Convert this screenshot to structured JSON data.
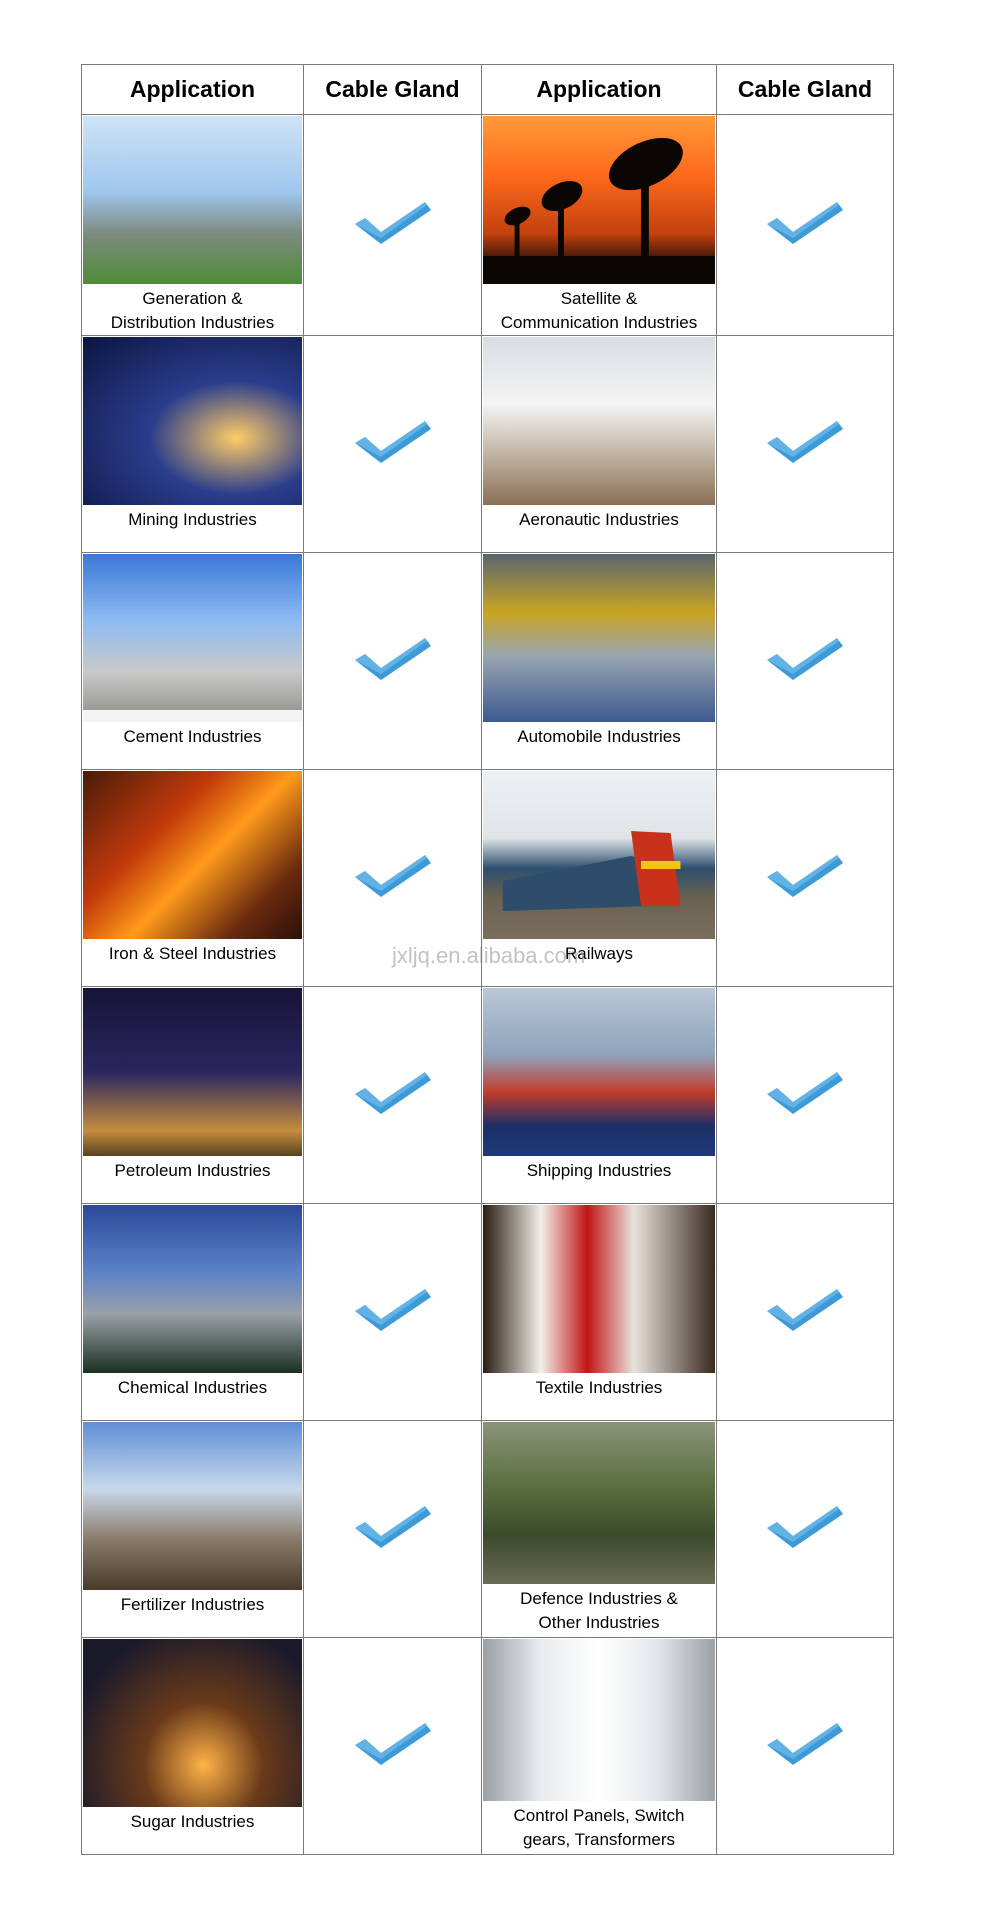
{
  "headers": [
    "Application",
    "Cable Gland",
    "Application",
    "Cable Gland"
  ],
  "rows": [
    {
      "left": {
        "caption": "Generation &\nDistribution Industries"
      },
      "right": {
        "caption": "Satellite &\nCommunication Industries"
      }
    },
    {
      "left": {
        "caption": "Mining Industries"
      },
      "right": {
        "caption": "Aeronautic Industries"
      }
    },
    {
      "left": {
        "caption": "Cement Industries"
      },
      "right": {
        "caption": "Automobile Industries"
      }
    },
    {
      "left": {
        "caption": "Iron & Steel Industries"
      },
      "right": {
        "caption": "Railways"
      }
    },
    {
      "left": {
        "caption": "Petroleum Industries"
      },
      "right": {
        "caption": "Shipping Industries"
      }
    },
    {
      "left": {
        "caption": "Chemical Industries"
      },
      "right": {
        "caption": "Textile Industries"
      }
    },
    {
      "left": {
        "caption": "Fertilizer Industries"
      },
      "right": {
        "caption": "Defence Industries &\nOther Industries"
      }
    },
    {
      "left": {
        "caption": "Sugar Industries"
      },
      "right": {
        "caption": "Control Panels, Switch\ngears, Transformers"
      }
    }
  ],
  "check_icon": "checkmark-icon",
  "check_color": "#3d9ad9",
  "watermark": "jxljq.en.alibaba.com"
}
